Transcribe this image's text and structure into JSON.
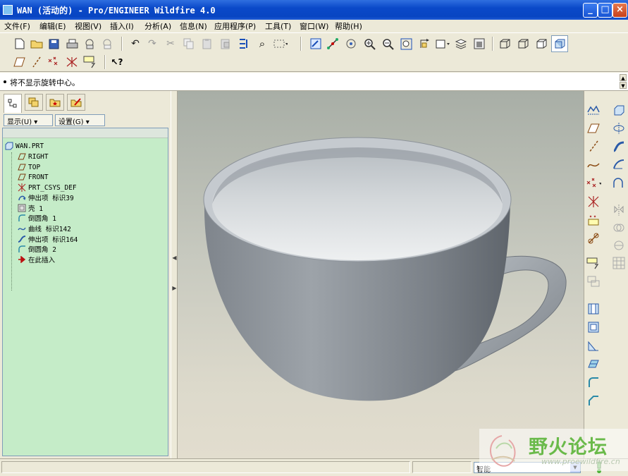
{
  "window": {
    "title": "WAN (活动的) - Pro/ENGINEER Wildfire 4.0",
    "minimize": "_",
    "maximize": "□",
    "close": "×"
  },
  "menu": [
    "文件(F)",
    "编辑(E)",
    "视图(V)",
    "插入(I)",
    "分析(A)",
    "信息(N)",
    "应用程序(P)",
    "工具(T)",
    "窗口(W)",
    "帮助(H)"
  ],
  "message": "将不显示旋转中心。",
  "nav": {
    "show_button": "显示(U) ▾",
    "settings_button": "设置(G) ▾",
    "tree": [
      {
        "label": "WAN.PRT",
        "icon": "part-icon"
      },
      {
        "label": "RIGHT",
        "icon": "datum-plane-icon"
      },
      {
        "label": "TOP",
        "icon": "datum-plane-icon"
      },
      {
        "label": "FRONT",
        "icon": "datum-plane-icon"
      },
      {
        "label": "PRT_CSYS_DEF",
        "icon": "csys-icon"
      },
      {
        "label": "伸出项 标识39",
        "icon": "revolve-icon"
      },
      {
        "label": "壳 1",
        "icon": "shell-icon"
      },
      {
        "label": "倒圆角 1",
        "icon": "round-icon"
      },
      {
        "label": "曲线 标识142",
        "icon": "curve-icon"
      },
      {
        "label": "伸出项 标识164",
        "icon": "sweep-icon"
      },
      {
        "label": "倒圆角 2",
        "icon": "round-icon"
      },
      {
        "label": "在此插入",
        "icon": "insert-here-icon"
      }
    ]
  },
  "status": {
    "filter": "智能"
  },
  "watermark": {
    "name": "野火论坛",
    "url": "www.proewildfire.cn"
  },
  "colors": {
    "titlebar": "#0a49c9",
    "tree_background": "#c5ecc8",
    "model": "#8f959b"
  }
}
